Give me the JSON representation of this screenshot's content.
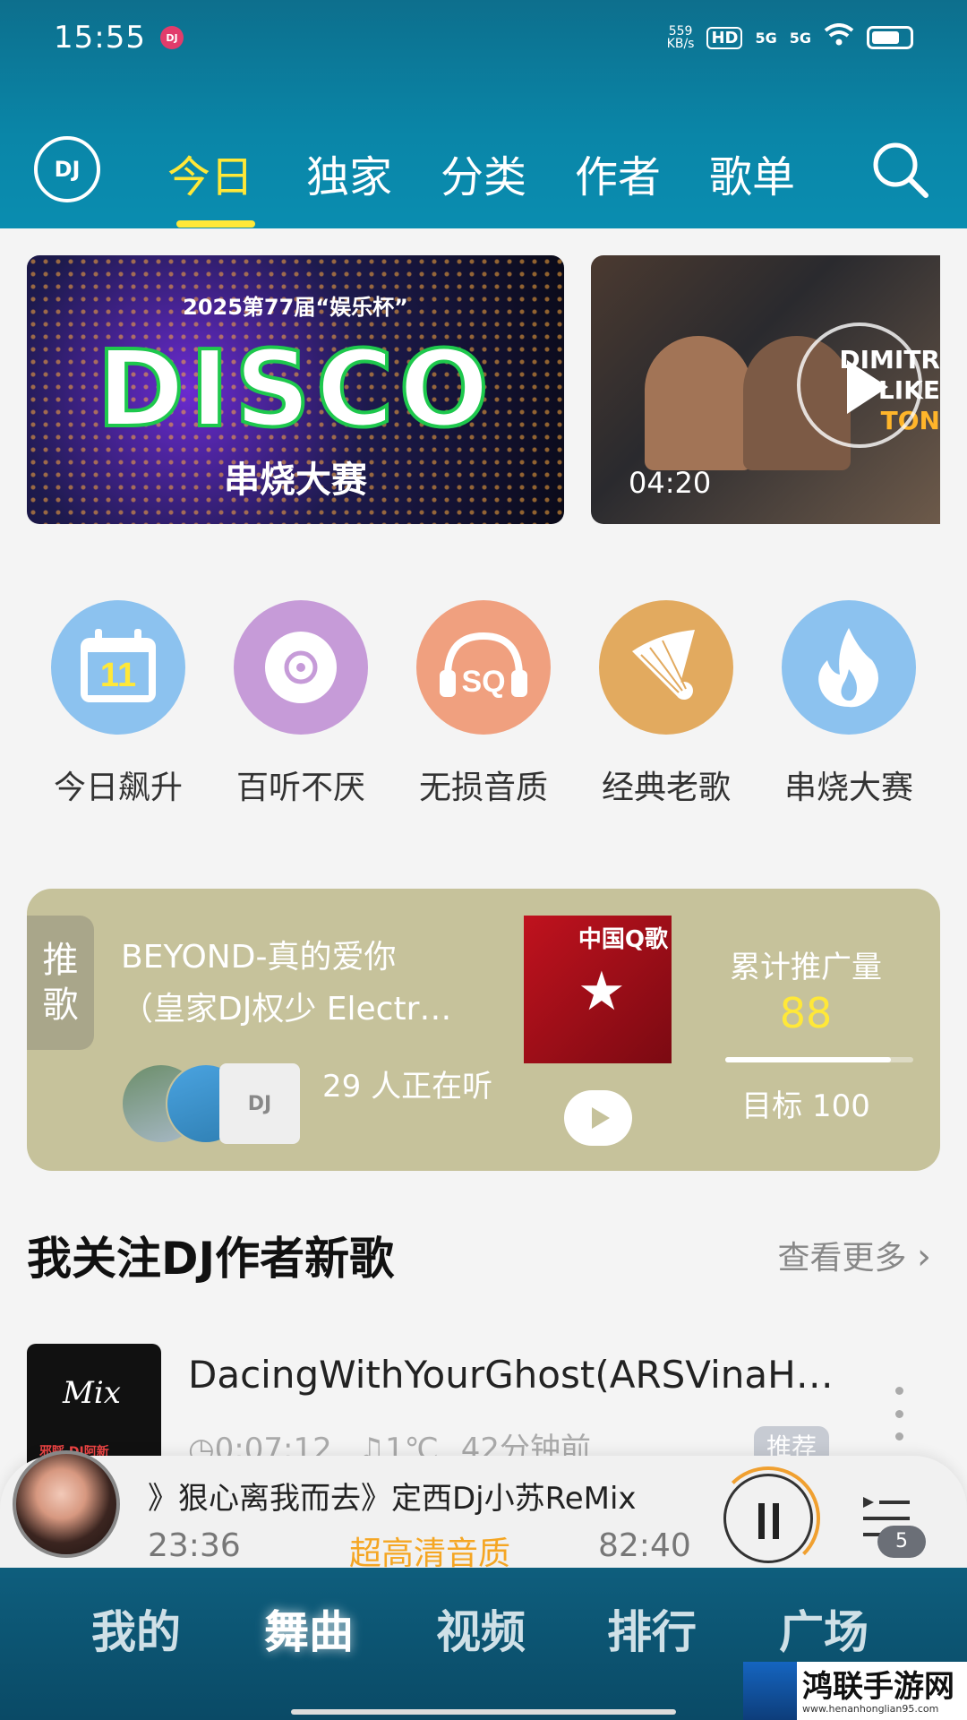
{
  "status": {
    "time": "15:55",
    "app_badge": "DJ",
    "speed": "559",
    "speed_unit": "KB/s",
    "hd": "HD",
    "sig1": "5G",
    "sig2": "5G"
  },
  "topnav": {
    "logo": "DJ",
    "tabs": [
      "今日",
      "独家",
      "分类",
      "作者",
      "歌单"
    ],
    "active_tab": "今日"
  },
  "banner_main": {
    "year": "2025第77届“娱乐杯”",
    "headline": "DISCO",
    "subtitle": "串烧大赛"
  },
  "banner_side": {
    "sign_line1": "DIMITR",
    "sign_line2": "LIKE",
    "sign_line3": "TON",
    "duration": "04:20"
  },
  "categories": [
    {
      "label": "今日飙升",
      "icon": "calendar-icon",
      "icon_text": "11",
      "color": "#8cc2ef"
    },
    {
      "label": "百听不厌",
      "icon": "disc-icon",
      "color": "#c69bd8"
    },
    {
      "label": "无损音质",
      "icon": "sq-headphones-icon",
      "icon_text": "SQ",
      "color": "#f0a07f"
    },
    {
      "label": "经典老歌",
      "icon": "gramophone-icon",
      "color": "#e2aa5f"
    },
    {
      "label": "串烧大赛",
      "icon": "flame-icon",
      "color": "#8cc2ef"
    }
  ],
  "promo": {
    "tag": "推歌",
    "title_line1": "BEYOND-真的爱你",
    "title_line2": "（皇家DJ权少 Electr…",
    "listeners": "29 人正在听",
    "cover_text": "中国Q歌",
    "stat_label": "累计推广量",
    "stat_value": "88",
    "goal": "目标 100",
    "progress_percent": 88
  },
  "section": {
    "title": "我关注DJ作者新歌",
    "more": "查看更多"
  },
  "song": {
    "name": "DacingWithYourGhost(ARSVinaH…",
    "duration": "0:07:12",
    "plays": "1℃",
    "time_ago": "42分钟前",
    "badge": "推荐",
    "thumb_text": "Mix",
    "thumb_sub": "邪睬 DJ阿新"
  },
  "player": {
    "title": "》狠心离我而去》定西Dj小苏ReMix",
    "elapsed": "23:36",
    "quality": "超高清音质",
    "total": "82:40",
    "queue_count": "5",
    "progress": 0.29
  },
  "bottomnav": {
    "items": [
      "我的",
      "舞曲",
      "视频",
      "排行",
      "广场"
    ],
    "active": "舞曲"
  },
  "watermark": {
    "title": "鸿联手游网",
    "url": "www.henanhonglian95.com"
  },
  "colors": {
    "header": "#0a86a8",
    "accent_yellow": "#ffe838",
    "promo_bg": "#c6c29b",
    "quality_orange": "#f5a623"
  }
}
